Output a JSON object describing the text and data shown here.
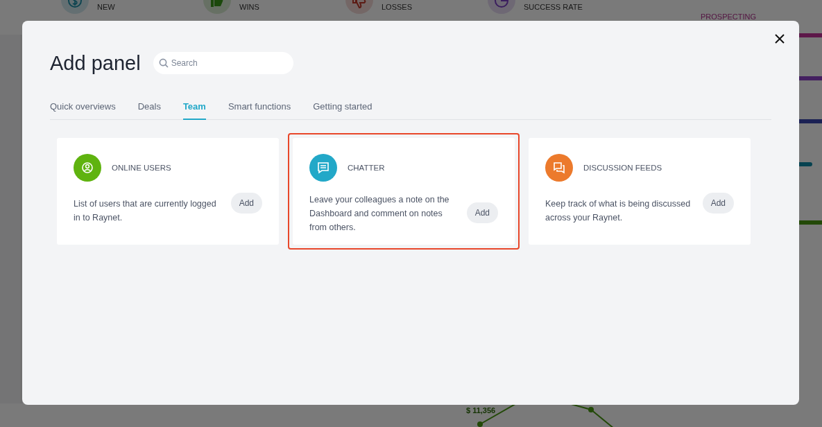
{
  "background": {
    "stats": [
      {
        "label": "NEW",
        "kind": "dollar"
      },
      {
        "label": "WINS",
        "kind": "thumb-up"
      },
      {
        "label": "LOSSES",
        "kind": "thumb-down"
      },
      {
        "label": "SUCCESS RATE",
        "kind": "pie"
      }
    ],
    "pipeline": {
      "title": "PROSPECTING"
    },
    "chart_label": "$ 11,356"
  },
  "dialog": {
    "title": "Add panel",
    "search": {
      "placeholder": "Search"
    },
    "tabs": [
      {
        "label": "Quick overviews",
        "selected": false
      },
      {
        "label": "Deals",
        "selected": false
      },
      {
        "label": "Team",
        "selected": true
      },
      {
        "label": "Smart functions",
        "selected": false
      },
      {
        "label": "Getting started",
        "selected": false
      }
    ],
    "panels": [
      {
        "title": "ONLINE USERS",
        "kind": "user",
        "color": "#5fb30f",
        "description": "List of users that are currently logged in to Raynet.",
        "button": "Add",
        "highlighted": false
      },
      {
        "title": "CHATTER",
        "kind": "chat",
        "color": "#22a8c8",
        "description": "Leave your colleagues a note on the Dashboard and comment on notes from others.",
        "button": "Add",
        "highlighted": true
      },
      {
        "title": "DISCUSSION FEEDS",
        "kind": "feeds",
        "color": "#ec7a2c",
        "description": "Keep track of what is being discussed across your Raynet.",
        "button": "Add",
        "highlighted": false
      }
    ]
  }
}
